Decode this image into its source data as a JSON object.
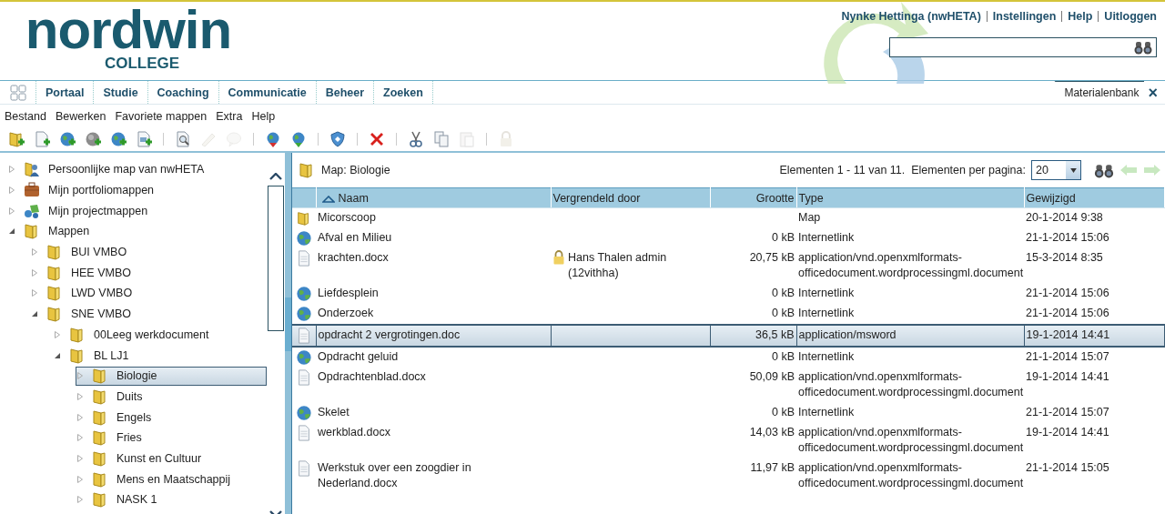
{
  "logo": {
    "name": "nordwin",
    "subtitle": "COLLEGE"
  },
  "user_links": [
    {
      "label": "Nynke Hettinga (nwHETA)"
    },
    {
      "label": "Instellingen"
    },
    {
      "label": "Help"
    },
    {
      "label": "Uitloggen"
    }
  ],
  "nav_tabs": [
    "Portaal",
    "Studie",
    "Coaching",
    "Communicatie",
    "Beheer",
    "Zoeken"
  ],
  "open_tab": {
    "label": "Materialenbank",
    "close": "×"
  },
  "menu": [
    "Bestand",
    "Bewerken",
    "Favoriete mappen",
    "Extra",
    "Help"
  ],
  "toolbar": [
    [
      {
        "kind": "add-folder",
        "disabled": false
      },
      {
        "kind": "add-document",
        "disabled": false
      },
      {
        "kind": "add-link",
        "disabled": false
      },
      {
        "kind": "add-search-link",
        "disabled": false
      },
      {
        "kind": "add-web",
        "disabled": false
      },
      {
        "kind": "add-image",
        "disabled": false
      }
    ],
    [
      {
        "kind": "preview",
        "disabled": false
      },
      {
        "kind": "edit",
        "disabled": true
      },
      {
        "kind": "comment",
        "disabled": true
      }
    ],
    [
      {
        "kind": "publish",
        "disabled": false
      },
      {
        "kind": "unpublish",
        "disabled": false
      }
    ],
    [
      {
        "kind": "sync",
        "disabled": false
      }
    ],
    [
      {
        "kind": "delete",
        "disabled": false
      }
    ],
    [
      {
        "kind": "cut",
        "disabled": false
      },
      {
        "kind": "copy",
        "disabled": false
      },
      {
        "kind": "paste",
        "disabled": true
      }
    ],
    [
      {
        "kind": "lock",
        "disabled": true
      }
    ]
  ],
  "tree": [
    {
      "label": "Persoonlijke map van nwHETA",
      "kind": "person",
      "expanded": false,
      "selected": false
    },
    {
      "label": "Mijn portfoliomappen",
      "kind": "briefcase",
      "expanded": false,
      "selected": false
    },
    {
      "label": "Mijn projectmappen",
      "kind": "project",
      "expanded": false,
      "selected": false
    },
    {
      "label": "Mappen",
      "kind": "folder",
      "expanded": true,
      "selected": false,
      "children": [
        {
          "label": "BUI VMBO",
          "kind": "folder",
          "expanded": false,
          "selected": false
        },
        {
          "label": "HEE VMBO",
          "kind": "folder",
          "expanded": false,
          "selected": false
        },
        {
          "label": "LWD VMBO",
          "kind": "folder",
          "expanded": false,
          "selected": false
        },
        {
          "label": "SNE VMBO",
          "kind": "folder",
          "expanded": true,
          "selected": false,
          "children": [
            {
              "label": "00Leeg werkdocument",
              "kind": "folder",
              "expanded": false,
              "selected": false
            },
            {
              "label": "BL LJ1",
              "kind": "folder",
              "expanded": true,
              "selected": false,
              "children": [
                {
                  "label": "Biologie",
                  "kind": "folder",
                  "expanded": false,
                  "selected": true
                },
                {
                  "label": "Duits",
                  "kind": "folder",
                  "expanded": false,
                  "selected": false
                },
                {
                  "label": "Engels",
                  "kind": "folder",
                  "expanded": false,
                  "selected": false
                },
                {
                  "label": "Fries",
                  "kind": "folder",
                  "expanded": false,
                  "selected": false
                },
                {
                  "label": "Kunst en Cultuur",
                  "kind": "folder",
                  "expanded": false,
                  "selected": false
                },
                {
                  "label": "Mens en Maatschappij",
                  "kind": "folder",
                  "expanded": false,
                  "selected": false
                },
                {
                  "label": "NASK 1",
                  "kind": "folder",
                  "expanded": false,
                  "selected": false
                }
              ]
            }
          ]
        }
      ]
    }
  ],
  "folder_title": "Map: Biologie",
  "paging": {
    "summary": "Elementen 1 - 11 van 11.  Elementen per pagina:",
    "per_page": "20"
  },
  "table": {
    "columns": [
      {
        "label": "Naam",
        "sorted": true
      },
      {
        "label": "Vergrendeld door",
        "sorted": false
      },
      {
        "label": "Grootte",
        "sorted": false
      },
      {
        "label": "Type",
        "sorted": false
      },
      {
        "label": "Gewijzigd",
        "sorted": false
      }
    ],
    "rows": [
      {
        "kind": "folder",
        "name": "Micorscoop",
        "type": "Map",
        "modified": "20-1-2014 9:38",
        "selected": false
      },
      {
        "kind": "link",
        "name": "Afval en Milieu",
        "size": "0 kB",
        "type": "Internetlink",
        "modified": "21-1-2014 15:06",
        "selected": false
      },
      {
        "kind": "document",
        "name": "krachten.docx",
        "locked_by": "Hans Thalen admin (12vithha)",
        "size": "20,75 kB",
        "type": "application/vnd.openxmlformats-officedocument.wordprocessingml.document",
        "modified": "15-3-2014 8:35",
        "selected": false
      },
      {
        "kind": "link",
        "name": "Liefdesplein",
        "size": "0 kB",
        "type": "Internetlink",
        "modified": "21-1-2014 15:06",
        "selected": false
      },
      {
        "kind": "link",
        "name": "Onderzoek",
        "size": "0 kB",
        "type": "Internetlink",
        "modified": "21-1-2014 15:06",
        "selected": false
      },
      {
        "kind": "document",
        "name": "opdracht 2 vergrotingen.doc",
        "size": "36,5 kB",
        "type": "application/msword",
        "modified": "19-1-2014 14:41",
        "selected": true
      },
      {
        "kind": "link",
        "name": "Opdracht geluid",
        "size": "0 kB",
        "type": "Internetlink",
        "modified": "21-1-2014 15:07",
        "selected": false
      },
      {
        "kind": "document",
        "name": "Opdrachtenblad.docx",
        "size": "50,09 kB",
        "type": "application/vnd.openxmlformats-officedocument.wordprocessingml.document",
        "modified": "19-1-2014 14:41",
        "selected": false
      },
      {
        "kind": "link",
        "name": "Skelet",
        "size": "0 kB",
        "type": "Internetlink",
        "modified": "21-1-2014 15:07",
        "selected": false
      },
      {
        "kind": "document",
        "name": "werkblad.docx",
        "size": "14,03 kB",
        "type": "application/vnd.openxmlformats-officedocument.wordprocessingml.document",
        "modified": "19-1-2014 14:41",
        "selected": false
      },
      {
        "kind": "document",
        "name": "Werkstuk over een zoogdier in Nederland.docx",
        "size": "11,97 kB",
        "type": "application/vnd.openxmlformats-officedocument.wordprocessingml.document",
        "modified": "21-1-2014 15:05",
        "selected": false
      }
    ]
  }
}
